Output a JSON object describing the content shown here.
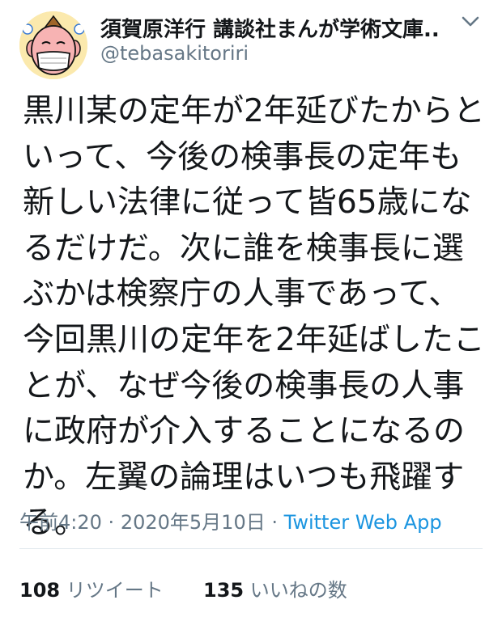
{
  "author": {
    "display_name": "須賀原洋行 講談社まんが学術文庫...",
    "handle": "@tebasakitoriri",
    "avatar_icon": "cartoon-face-avatar-icon",
    "menu_icon": "chevron-down-icon"
  },
  "tweet": {
    "text": "黒川某の定年が2年延びたからと\nいって、今後の検事長の定年も\n新しい法律に従って皆65歳にな\nるだけだ。次に誰を検事長に選\nぶかは検察庁の人事であって、\n今回黒川の定年を2年延ばしたこ\nとが、なぜ今後の検事長の人事\nに政府が介入することになるの\nか。左翼の論理はいつも飛躍す\nる。",
    "time": "午前4:20",
    "separator": "·",
    "date": "2020年5月10日",
    "source": "Twitter Web App"
  },
  "stats": {
    "retweet_count": "108",
    "retweet_label": "リツイート",
    "like_count": "135",
    "like_label": "いいねの数"
  },
  "colors": {
    "text": "#14171a",
    "secondary": "#657786",
    "link": "#1b95e0",
    "divider": "#e1e8ed"
  }
}
